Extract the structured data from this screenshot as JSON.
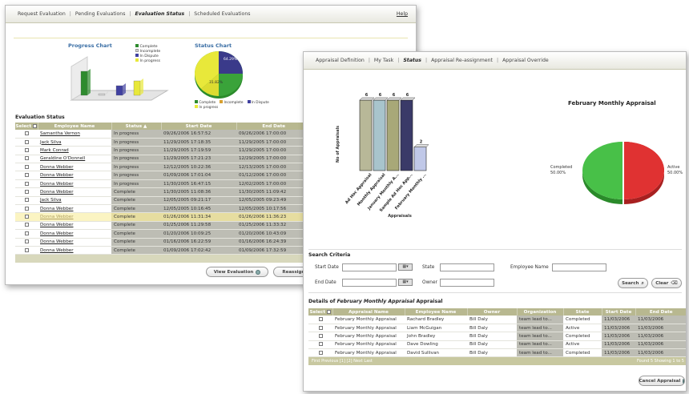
{
  "window1": {
    "nav": {
      "items": [
        "Request Evaluation",
        "Pending Evaluations",
        "Evaluation Status",
        "Scheduled Evaluations"
      ],
      "help": "Help"
    },
    "progress_chart": {
      "title": "Progress Chart",
      "legend": [
        "Complete",
        "Incomplete",
        "In Dispute",
        "In progress"
      ],
      "colors": [
        "#2e8b2e",
        "#d8d8d8",
        "#4040a0",
        "#e8e83a"
      ]
    },
    "status_chart": {
      "title": "Status Chart",
      "labels": [
        "64.29%",
        "31.82%"
      ],
      "legend": [
        "Complete",
        "Incomplete",
        "In Dispute",
        "In progress"
      ]
    },
    "section_title": "Evaluation Status",
    "table": {
      "headers": [
        "Select",
        "Employee Name",
        "Status",
        "Start Date",
        "End Date"
      ],
      "rows": [
        [
          "Samantha Vernon",
          "In progress",
          "09/26/2006 16:57:52",
          "09/26/2006 17:00:00"
        ],
        [
          "Jack Silva",
          "In progress",
          "11/29/2005 17:18:35",
          "11/29/2005 17:00:00"
        ],
        [
          "Mark Conrad",
          "In progress",
          "11/29/2005 17:19:59",
          "11/29/2005 17:00:00"
        ],
        [
          "Geraldine O'Donnell",
          "In progress",
          "11/29/2005 17:21:23",
          "12/29/2005 17:00:00"
        ],
        [
          "Donna Webber",
          "In progress",
          "12/12/2005 10:22:36",
          "12/13/2005 17:00:00"
        ],
        [
          "Donna Webber",
          "In progress",
          "01/09/2006 17:01:04",
          "01/12/2006 17:00:00"
        ],
        [
          "Donna Webber",
          "In progress",
          "11/30/2005 16:47:15",
          "12/02/2005 17:00:00"
        ],
        [
          "Donna Webber",
          "Complete",
          "11/30/2005 11:08:36",
          "11/30/2005 11:09:42"
        ],
        [
          "Jack Silva",
          "Complete",
          "12/05/2005 09:21:17",
          "12/05/2005 09:23:49"
        ],
        [
          "Donna Webber",
          "Complete",
          "12/05/2005 10:16:45",
          "12/05/2005 10:17:56"
        ],
        [
          "Donna Webber",
          "Complete",
          "01/26/2006 11:31:34",
          "01/26/2006 11:36:23"
        ],
        [
          "Donna Webber",
          "Complete",
          "01/25/2006 11:29:58",
          "01/25/2006 11:33:32"
        ],
        [
          "Donna Webber",
          "Complete",
          "01/20/2006 10:09:25",
          "01/20/2006 10:43:09"
        ],
        [
          "Donna Webber",
          "Complete",
          "01/16/2006 16:22:59",
          "01/16/2006 16:24:39"
        ],
        [
          "Donna Webber",
          "Complete",
          "01/09/2006 17:02:42",
          "01/09/2006 17:32:59"
        ]
      ]
    },
    "buttons": {
      "view": "View Evaluation",
      "reassign": "Reassign Ev"
    }
  },
  "window2": {
    "nav": {
      "items": [
        "Appraisal Definition",
        "My Task",
        "Status",
        "Appraisal Re-assignment",
        "Appraisal Override"
      ]
    },
    "chart_data": [
      {
        "type": "bar",
        "categories": [
          "Ad Hoc Appraisal",
          "Monthly Appraisal",
          "January Monthly A...",
          "Sample Ad Hoc App...",
          "February Monthly ..."
        ],
        "values": [
          6,
          6,
          6,
          6,
          2
        ],
        "data_labels": [
          "6",
          "6",
          "6",
          "6",
          "2"
        ],
        "xlabel": "Appraisals",
        "ylabel": "No of Appraisals",
        "colors": [
          "#b8b898",
          "#a8c4cc",
          "#a8a878",
          "#3a3a68",
          "#c0c8e8"
        ]
      },
      {
        "type": "pie",
        "title": "February Monthly Appraisal",
        "slices": [
          {
            "label": "Completed",
            "value": 50.0,
            "value_label": "50.00%",
            "color": "#3cb83c"
          },
          {
            "label": "Active",
            "value": 50.0,
            "value_label": "50.00%",
            "color": "#e03030"
          }
        ]
      }
    ],
    "search": {
      "title": "Search Criteria",
      "start_date": "Start Date",
      "end_date": "End Date",
      "state": "State",
      "owner": "Owner",
      "employee_name": "Employee Name",
      "search_btn": "Search",
      "clear_btn": "Clear"
    },
    "details": {
      "prefix": "Details of ",
      "name": "February Monthly Appraisal",
      "suffix": " Appraisal"
    },
    "table": {
      "headers": [
        "Select",
        "Appraisal Name",
        "Employee Name",
        "Owner",
        "Organization",
        "State",
        "Start Date",
        "End Date"
      ],
      "rows": [
        [
          "February Monthly Appraisal",
          "Rachard Bradley",
          "Bill Daly",
          "team lead to...",
          "Completed",
          "11/03/2006",
          "11/03/2006"
        ],
        [
          "February Monthly Appraisal",
          "Liam McGuigan",
          "Bill Daly",
          "team lead to...",
          "Active",
          "11/03/2006",
          "11/03/2006"
        ],
        [
          "February Monthly Appraisal",
          "John Bradley",
          "Bill Daly",
          "team lead to...",
          "Completed",
          "11/03/2006",
          "11/03/2006"
        ],
        [
          "February Monthly Appraisal",
          "Dave Dowling",
          "Bill Daly",
          "team lead to...",
          "Active",
          "11/03/2006",
          "11/03/2006"
        ],
        [
          "February Monthly Appraisal",
          "David Sullivan",
          "Bill Daly",
          "team lead to...",
          "Completed",
          "11/03/2006",
          "11/03/2006"
        ]
      ],
      "pager_left": "First Previous [1] [2] Next Last",
      "pager_right": "Found 5 Showing 1 to 5"
    },
    "cancel_btn": "Cancel Appraisal"
  }
}
